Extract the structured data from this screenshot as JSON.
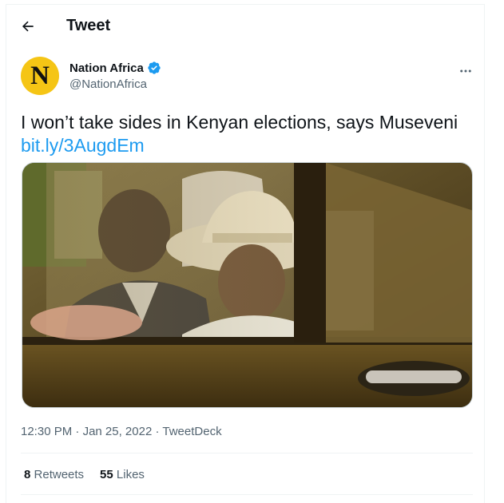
{
  "header": {
    "title": "Tweet"
  },
  "author": {
    "avatar_letter": "N",
    "name": "Nation Africa",
    "handle": "@NationAfrica",
    "verified": true
  },
  "tweet": {
    "text": "I won’t take sides in Kenyan elections, says Museveni",
    "link": "bit.ly/3AugdEm"
  },
  "meta": {
    "time": "12:30 PM",
    "sep1": " · ",
    "date": "Jan 25, 2022",
    "sep2": " · ",
    "source": "TweetDeck"
  },
  "stats": {
    "retweets_count": "8",
    "retweets_label": "Retweets",
    "likes_count": "55",
    "likes_label": "Likes"
  },
  "colors": {
    "accent": "#1d9bf0",
    "avatar_bg": "#f5c515",
    "text": "#0f1419",
    "muted": "#536471"
  },
  "icons": {
    "back": "arrow-left-icon",
    "verified": "verified-badge-icon",
    "more": "more-horizontal-icon"
  }
}
